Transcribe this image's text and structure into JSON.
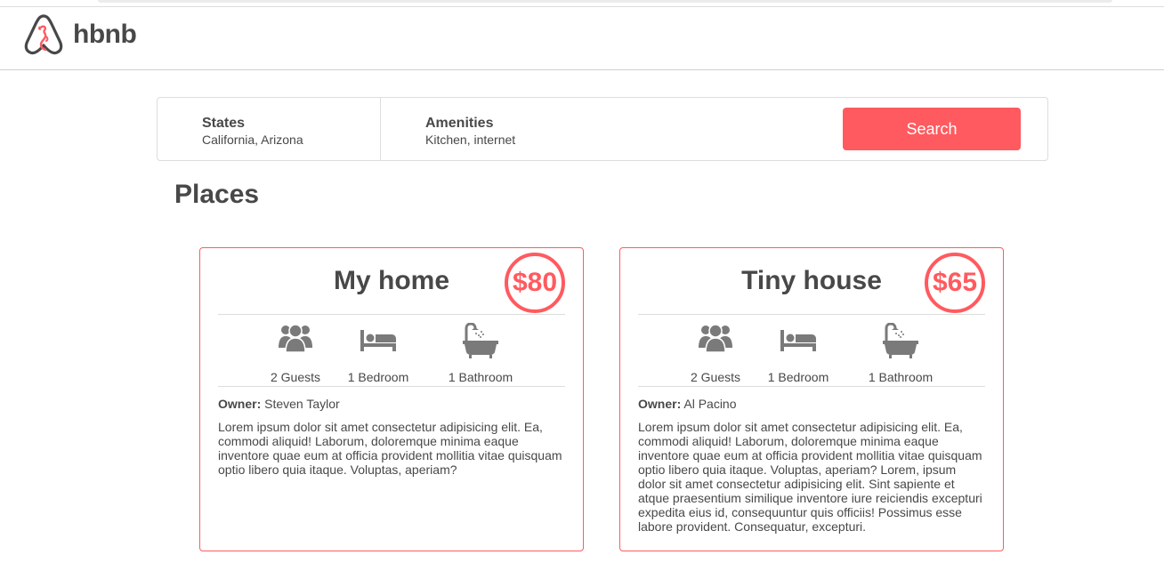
{
  "header": {
    "logo_text": "hbnb",
    "logo_icon": "airbnb-logo-icon"
  },
  "filters": {
    "states": {
      "title": "States",
      "value": "California, Arizona"
    },
    "amenities": {
      "title": "Amenities",
      "value": "Kitchen, internet"
    },
    "search_label": "Search"
  },
  "places": {
    "title": "Places",
    "items": [
      {
        "name": "My home",
        "price": "$80",
        "guests": "2 Guests",
        "bedrooms": "1 Bedroom",
        "bathrooms": "1 Bathroom",
        "owner_label": "Owner:",
        "owner": "Steven Taylor",
        "description": "Lorem ipsum dolor sit amet consectetur adipisicing elit. Ea, commodi aliquid! Laborum, doloremque minima eaque inventore quae eum at officia provident mollitia vitae quisquam optio libero quia itaque. Voluptas, aperiam?"
      },
      {
        "name": "Tiny house",
        "price": "$65",
        "guests": "2 Guests",
        "bedrooms": "1 Bedroom",
        "bathrooms": "1 Bathroom",
        "owner_label": "Owner:",
        "owner": "Al Pacino",
        "description": "Lorem ipsum dolor sit amet consectetur adipisicing elit. Ea, commodi aliquid! Laborum, doloremque minima eaque inventore quae eum at officia provident mollitia vitae quisquam optio libero quia itaque. Voluptas, aperiam? Lorem, ipsum dolor sit amet consectetur adipisicing elit. Sint sapiente et atque praesentium similique inventore iure reiciendis excepturi expedita eius id, consequuntur quis officiis! Possimus esse labore provident. Consequatur, excepturi."
      }
    ]
  },
  "colors": {
    "accent": "#ff5a5f",
    "text": "#484848",
    "border": "#dddddd",
    "icon": "#7a7a7a"
  }
}
